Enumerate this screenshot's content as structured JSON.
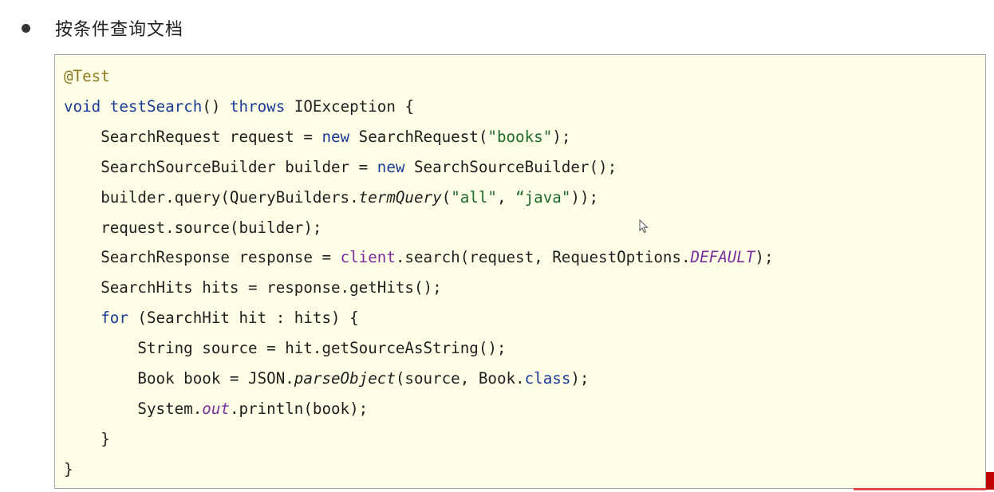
{
  "heading": {
    "text": "按条件查询文档"
  },
  "code": {
    "lines": [
      [
        {
          "t": "@Test",
          "c": "annotation"
        }
      ],
      [
        {
          "t": "void",
          "c": "keyword"
        },
        {
          "t": " "
        },
        {
          "t": "testSearch",
          "c": "keyword"
        },
        {
          "t": "() "
        },
        {
          "t": "throws",
          "c": "keyword"
        },
        {
          "t": " IOException {"
        }
      ],
      [
        {
          "t": "    SearchRequest request = "
        },
        {
          "t": "new",
          "c": "keyword"
        },
        {
          "t": " SearchRequest("
        },
        {
          "t": "\"books\"",
          "c": "string"
        },
        {
          "t": ");"
        }
      ],
      [
        {
          "t": "    SearchSourceBuilder builder = "
        },
        {
          "t": "new",
          "c": "keyword"
        },
        {
          "t": " SearchSourceBuilder();"
        }
      ],
      [
        {
          "t": "    builder.query(QueryBuilders."
        },
        {
          "t": "termQuery",
          "c": "italic"
        },
        {
          "t": "("
        },
        {
          "t": "\"all\"",
          "c": "string"
        },
        {
          "t": ", "
        },
        {
          "t": "“java\"",
          "c": "string"
        },
        {
          "t": "));"
        }
      ],
      [
        {
          "t": "    request.source(builder);"
        }
      ],
      [
        {
          "t": "    SearchResponse response = "
        },
        {
          "t": "client",
          "c": "field"
        },
        {
          "t": ".search(request, RequestOptions."
        },
        {
          "t": "DEFAULT",
          "c": "italic-field"
        },
        {
          "t": ");"
        }
      ],
      [
        {
          "t": "    SearchHits hits = response.getHits();"
        }
      ],
      [
        {
          "t": "    "
        },
        {
          "t": "for",
          "c": "keyword"
        },
        {
          "t": " (SearchHit hit : hits) {"
        }
      ],
      [
        {
          "t": "        String source = hit.getSourceAsString();"
        }
      ],
      [
        {
          "t": "        Book book = JSON."
        },
        {
          "t": "parseObject",
          "c": "italic"
        },
        {
          "t": "(source, Book."
        },
        {
          "t": "class",
          "c": "keyword"
        },
        {
          "t": ");"
        }
      ],
      [
        {
          "t": "        System."
        },
        {
          "t": "out",
          "c": "italic-field"
        },
        {
          "t": ".println(book);"
        }
      ],
      [
        {
          "t": "    }"
        }
      ],
      [
        {
          "t": "}"
        }
      ]
    ]
  }
}
